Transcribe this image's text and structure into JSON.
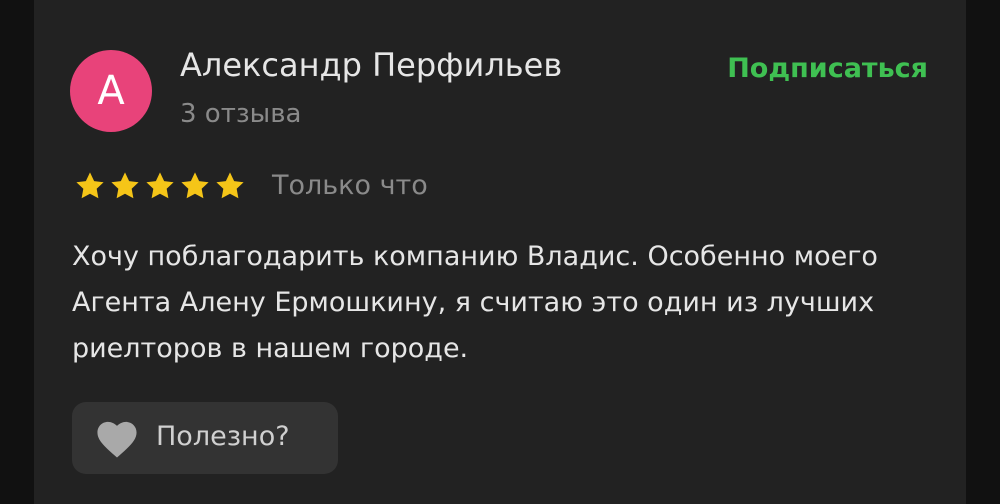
{
  "author": {
    "avatar_letter": "А",
    "avatar_color": "#e8437a",
    "name": "Александр Перфильев",
    "review_count": "3 отзыва"
  },
  "subscribe_label": "Подписаться",
  "accent_color": "#3fc052",
  "rating": {
    "stars": 5,
    "max": 5,
    "star_color": "#f5c518"
  },
  "review": {
    "time": "Только что",
    "text": "Хочу поблагодарить компанию Владис. Особенно моего Агента Алену Ермошкину, я считаю это один из лучших риелторов в нашем городе."
  },
  "helpful": {
    "icon": "heart-icon",
    "label": "Полезно?"
  }
}
